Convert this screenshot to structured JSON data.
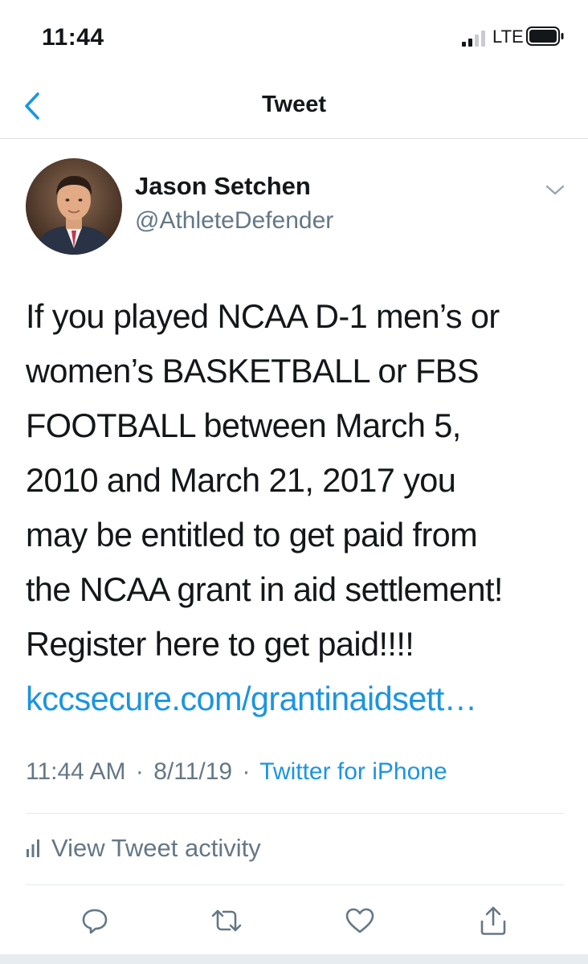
{
  "status_bar": {
    "time": "11:44",
    "network": "LTE"
  },
  "nav": {
    "title": "Tweet",
    "back_icon": "chevron-left-icon",
    "accent_color": "#1b95e0"
  },
  "tweet": {
    "author_name": "Jason Setchen",
    "author_handle": "@AthleteDefender",
    "text_lines": [
      "If you played NCAA D-1 men’s or",
      "women’s BASKETBALL or FBS",
      "FOOTBALL between March 5,",
      "2010 and March 21, 2017 you",
      "may be entitled to get paid from",
      "the NCAA grant in aid settlement!",
      "Register here to get paid!!!!"
    ],
    "link_text": "kccsecure.com/grantinaidsett…",
    "time": "11:44 AM",
    "date": "8/11/19",
    "separator": "·",
    "source": "Twitter for iPhone"
  },
  "activity": {
    "label": "View Tweet activity",
    "icon": "bar-chart-icon"
  },
  "actions": {
    "reply_icon": "reply-icon",
    "retweet_icon": "retweet-icon",
    "like_icon": "heart-icon",
    "share_icon": "share-icon"
  }
}
